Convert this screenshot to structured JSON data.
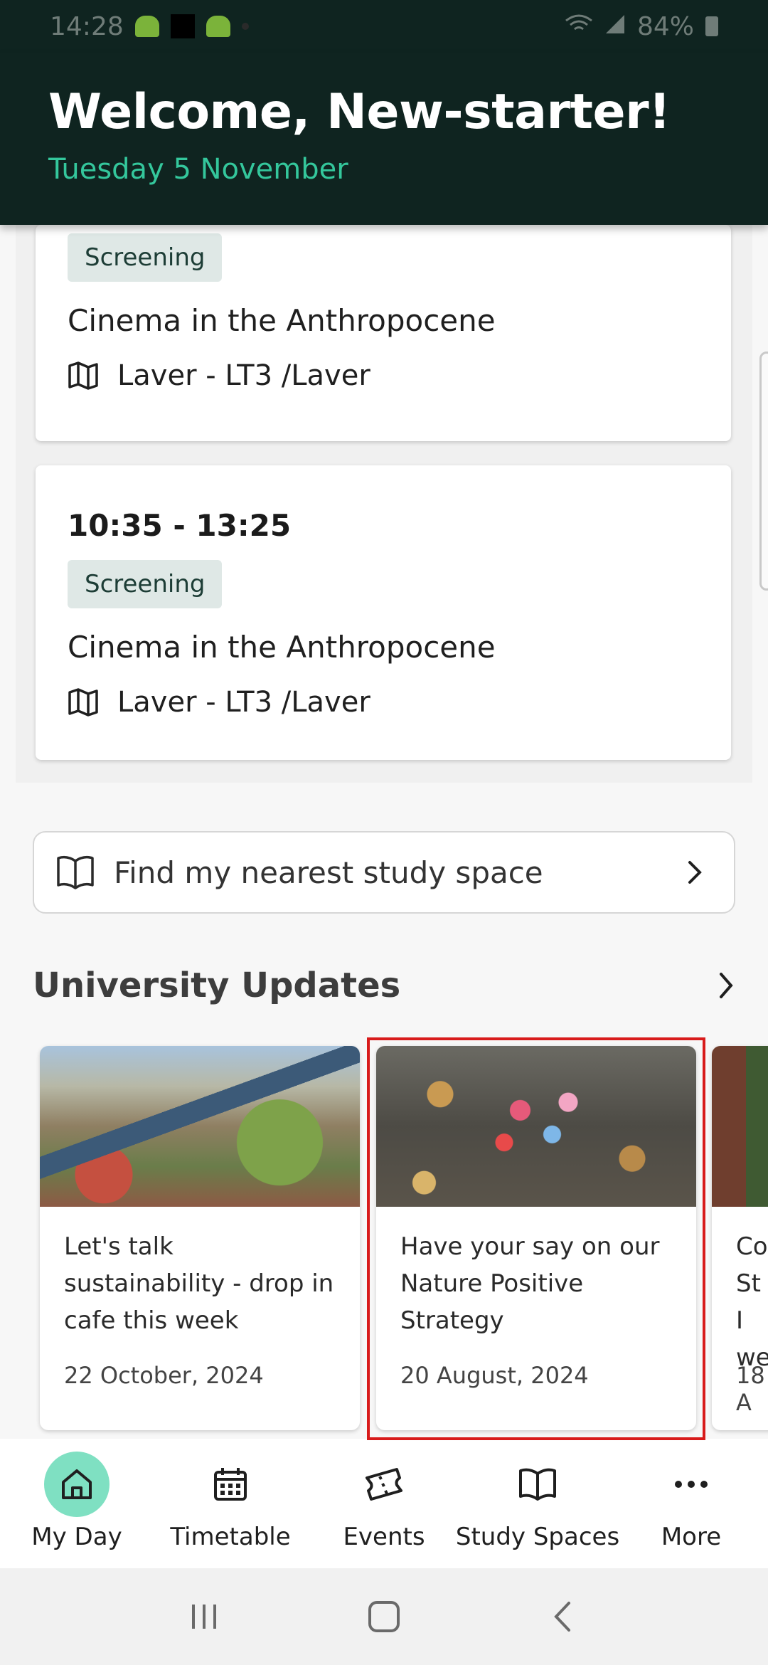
{
  "status_bar": {
    "time": "14:28",
    "battery": "84%"
  },
  "header": {
    "welcome": "Welcome, New-starter!",
    "date": "Tuesday 5 November"
  },
  "timetable": {
    "cards": [
      {
        "time": "",
        "type": "Screening",
        "course": "Cinema in the Anthropocene",
        "location": "Laver - LT3 /Laver"
      },
      {
        "time": "10:35 - 13:25",
        "type": "Screening",
        "course": "Cinema in the Anthropocene",
        "location": "Laver - LT3 /Laver"
      }
    ]
  },
  "find_study_space": {
    "label": "Find my nearest study space"
  },
  "updates": {
    "title": "University Updates",
    "items": [
      {
        "title": "Let's talk sustainability - drop in cafe this week",
        "date": "22 October, 2024"
      },
      {
        "title": "Have your say on our Nature Positive Strategy",
        "date": "20 August, 2024"
      },
      {
        "title": "Co St I we",
        "date": "18 A"
      }
    ]
  },
  "bottom_nav": {
    "items": [
      {
        "label": "My Day",
        "icon": "home-icon",
        "active": true
      },
      {
        "label": "Timetable",
        "icon": "calendar-icon"
      },
      {
        "label": "Events",
        "icon": "ticket-icon"
      },
      {
        "label": "Study Spaces",
        "icon": "book-icon"
      },
      {
        "label": "More",
        "icon": "more-icon"
      }
    ]
  },
  "colors": {
    "header_bg": "#0f2420",
    "accent": "#34c79c",
    "active_nav": "#7fe0c2",
    "highlight": "#d81b1b"
  }
}
